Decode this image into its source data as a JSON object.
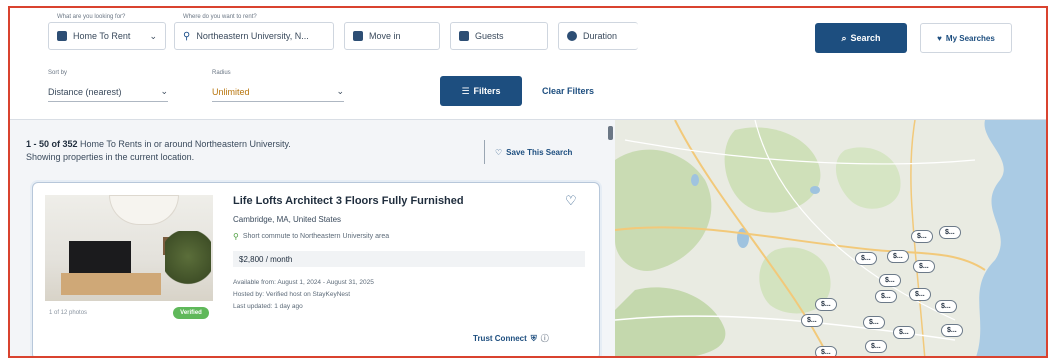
{
  "search": {
    "type_label": "What are you looking for?",
    "type_value": "Home To Rent",
    "location_label": "Where do you want to rent?",
    "location_value": "Northeastern University, N...",
    "move_in": "Move in",
    "guests": "Guests",
    "duration": "Duration",
    "search_button": "Search",
    "my_searches_button": "My Searches"
  },
  "sort": {
    "sort_label": "Sort by",
    "sort_value": "Distance (nearest)",
    "radius_label": "Radius",
    "radius_value": "Unlimited",
    "filters_button": "Filters",
    "clear_filters": "Clear Filters"
  },
  "results": {
    "count_bold": "1 - 50 of 352",
    "count_rest": " Home To Rents in or around Northeastern University.",
    "count_line2": "Showing properties in the current location.",
    "save_search": "Save This Search"
  },
  "listing": {
    "title": "Life Lofts Architect 3 Floors Fully Furnished",
    "location": "Cambridge, MA, United States",
    "commute": "Short commute to Northeastern University area",
    "price": "$2,800 / month",
    "available": "Available from: August 1, 2024 - August 31, 2025",
    "hosted_by": "Hosted by: Verified host on StayKeyNest",
    "last_updated": "Last updated: 1 day ago",
    "photo_caption": "1 of 12 photos",
    "verified_badge": "Verified",
    "trust_label": "Trust Connect"
  },
  "map_markers": [
    "$...",
    "$...",
    "$...",
    "$...",
    "$...",
    "$...",
    "$...",
    "$...",
    "$...",
    "$...",
    "$...",
    "$...",
    "$...",
    "$...",
    "$...",
    "$..."
  ],
  "colors": {
    "brand": "#1d4e7f",
    "verified": "#5fb85a",
    "frame": "#d9432f"
  }
}
